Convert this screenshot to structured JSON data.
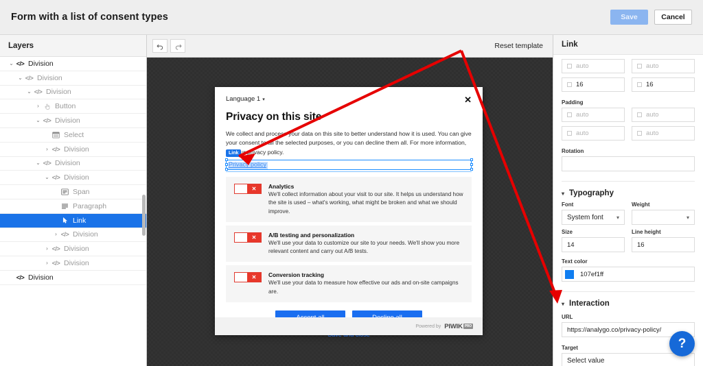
{
  "topbar": {
    "title": "Form with a list of consent types",
    "save_label": "Save",
    "cancel_label": "Cancel"
  },
  "layers": {
    "header": "Layers",
    "items": [
      {
        "label": "Division",
        "depth": 0,
        "caret": "down",
        "icon": "code-icon"
      },
      {
        "label": "Division",
        "depth": 1,
        "caret": "down",
        "icon": "code-icon"
      },
      {
        "label": "Division",
        "depth": 2,
        "caret": "down",
        "icon": "code-icon"
      },
      {
        "label": "Button",
        "depth": 3,
        "caret": "right",
        "icon": "pointer-hand-icon"
      },
      {
        "label": "Division",
        "depth": 3,
        "caret": "down",
        "icon": "code-icon"
      },
      {
        "label": "Select",
        "depth": 4,
        "caret": "none",
        "icon": "select-icon"
      },
      {
        "label": "Division",
        "depth": 4,
        "caret": "right",
        "icon": "code-icon"
      },
      {
        "label": "Division",
        "depth": 3,
        "caret": "down",
        "icon": "code-icon"
      },
      {
        "label": "Division",
        "depth": 4,
        "caret": "down",
        "icon": "code-icon"
      },
      {
        "label": "Span",
        "depth": 5,
        "caret": "none",
        "icon": "span-icon"
      },
      {
        "label": "Paragraph",
        "depth": 5,
        "caret": "none",
        "icon": "paragraph-icon"
      },
      {
        "label": "Link",
        "depth": 5,
        "caret": "none",
        "icon": "cursor-icon",
        "selected": true
      },
      {
        "label": "Division",
        "depth": 5,
        "caret": "right",
        "icon": "code-icon"
      },
      {
        "label": "Division",
        "depth": 4,
        "caret": "right",
        "icon": "code-icon"
      },
      {
        "label": "Division",
        "depth": 4,
        "caret": "right",
        "icon": "code-icon"
      },
      {
        "label": "Division",
        "depth": 0,
        "caret": "none",
        "icon": "code-icon"
      }
    ]
  },
  "canvas_toolbar": {
    "undo_icon": "undo-arrow-icon",
    "redo_icon": "redo-arrow-icon",
    "reset_label": "Reset template"
  },
  "consent": {
    "language_label": "Language 1",
    "close_icon": "close-icon",
    "title": "Privacy on this site",
    "description": "We collect and process your data on this site to better understand how it is used. You can give your consent to all the selected purposes, or you can decline them all. For more information, see our privacy policy.",
    "selected_element": {
      "badge": "Link",
      "text": "Privacy policy"
    },
    "items": [
      {
        "title": "Analytics",
        "description": "We'll collect information about your visit to our site. It helps us understand how the site is used – what's working, what might be broken and what we should improve.",
        "toggle_state": "off",
        "toggle_glyph": "✕"
      },
      {
        "title": "A/B testing and personalization",
        "description": "We'll use your data to customize our site to your needs. We'll show you more relevant content and carry out A/B tests.",
        "toggle_state": "off",
        "toggle_glyph": "✕"
      },
      {
        "title": "Conversion tracking",
        "description": "We'll use your data to measure how effective our ads and on-site campaigns are.",
        "toggle_state": "off",
        "toggle_glyph": "✕"
      }
    ],
    "accept_label": "Accept all",
    "decline_label": "Decline all",
    "save_close_label": "Save and close",
    "footer": {
      "powered_by": "Powered by",
      "brand": "PIWIK",
      "brand_badge": "PRO"
    }
  },
  "props": {
    "header": "Link",
    "margin_fields": [
      {
        "value": "auto",
        "placeholder": true
      },
      {
        "value": "auto",
        "placeholder": true
      },
      {
        "value": "16",
        "placeholder": false
      },
      {
        "value": "16",
        "placeholder": false
      }
    ],
    "padding_label": "Padding",
    "padding_fields": [
      {
        "value": "auto",
        "placeholder": true
      },
      {
        "value": "auto",
        "placeholder": true
      },
      {
        "value": "auto",
        "placeholder": true
      },
      {
        "value": "auto",
        "placeholder": true
      }
    ],
    "rotation_label": "Rotation",
    "rotation_value": "",
    "typography": {
      "section_label": "Typography",
      "font_label": "Font",
      "font_value": "System font",
      "weight_label": "Weight",
      "weight_value": "",
      "size_label": "Size",
      "size_value": "14",
      "line_height_label": "Line height",
      "line_height_value": "16",
      "text_color_label": "Text color",
      "text_color_value": "107ef1ff",
      "text_color_hex": "#107ef1"
    },
    "interaction": {
      "section_label": "Interaction",
      "url_label": "URL",
      "url_value": "https://analygo.co/privacy-policy/",
      "target_label": "Target",
      "target_value": "Select value"
    }
  },
  "help": {
    "icon": "question-mark-icon",
    "label": "?"
  },
  "colors": {
    "accent_blue": "#1a73e8",
    "link_blue": "#107ef1",
    "toggle_red": "#e8372a",
    "annotation_red": "#e60000"
  }
}
